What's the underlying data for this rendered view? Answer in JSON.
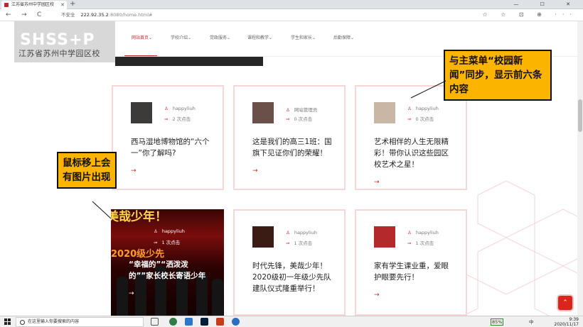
{
  "browser": {
    "tab_title": "江苏省苏州中学园区校",
    "new_tab": "+",
    "win_controls": "— ☐ ✕",
    "nav_back": "←",
    "nav_forward": "→",
    "nav_reload": "C",
    "security_label": "不安全",
    "url_host": "222.92.35.2",
    "url_path": ":8080/home.html#",
    "right_icons": "☆ ☆ ⊡ ⊕ ···"
  },
  "site": {
    "logo_en": "SHSS+P",
    "logo_cn": "江苏省苏州中学园区校",
    "menu": [
      {
        "label": "网站首页",
        "active": true
      },
      {
        "label": "学校介绍",
        "active": false
      },
      {
        "label": "党政服务",
        "active": false
      },
      {
        "label": "课程和教学",
        "active": false
      },
      {
        "label": "学生和家长",
        "active": false
      },
      {
        "label": "后勤保障",
        "active": false
      }
    ],
    "menu_chevron": "⌄"
  },
  "cards": [
    {
      "author": "happyliuh",
      "clicks": "2 次点击",
      "title": "西马湿地博物馆的“六个一”你了解吗?",
      "thumb_color": "#3d3a3a"
    },
    {
      "author": "网站管理员",
      "clicks": "0 次点击",
      "title": "这是我们的高三1班：国旗下见证你们的荣耀！",
      "thumb_color": "#6a5048"
    },
    {
      "author": "happyliuh",
      "clicks": "0 次点击",
      "title": "艺术相伴的人生无限精彩！带你认识这些园区校艺术之星！",
      "thumb_color": "#c9b6a4"
    },
    {
      "author": "happyliuh",
      "clicks": "1 次点击",
      "title": "“幸福的”“洒泼泼的””家长校长寄语少年",
      "thumb_color": "#5a0a0a"
    },
    {
      "author": "happyliuh",
      "clicks": "1 次点击",
      "title": "时代先锋，美哉少年！2020级初一年级少先队建队仪式隆重举行！",
      "thumb_color": "#3a1c14"
    },
    {
      "author": "happyliuh",
      "clicks": "1 次点击",
      "title": "家有学生课业重，爱眼护眼要先行！",
      "thumb_color": "#b42a2a"
    }
  ],
  "hover_banner": "美哉少年！",
  "hover_banner2": "2020级少先",
  "card_icons": {
    "author": "♙",
    "clicks": "⇒",
    "arrow": "→"
  },
  "notes": {
    "note1": "与主菜单“校园新闻”同步，显示前六条内容",
    "note2": "鼠标移上会有图片出现"
  },
  "back_to_top": "⌃",
  "taskbar": {
    "search_placeholder": "在这里输入你要搜索的内容",
    "battery": "85%",
    "ime": "中",
    "time": "9:39",
    "date": "2020/11/17"
  }
}
